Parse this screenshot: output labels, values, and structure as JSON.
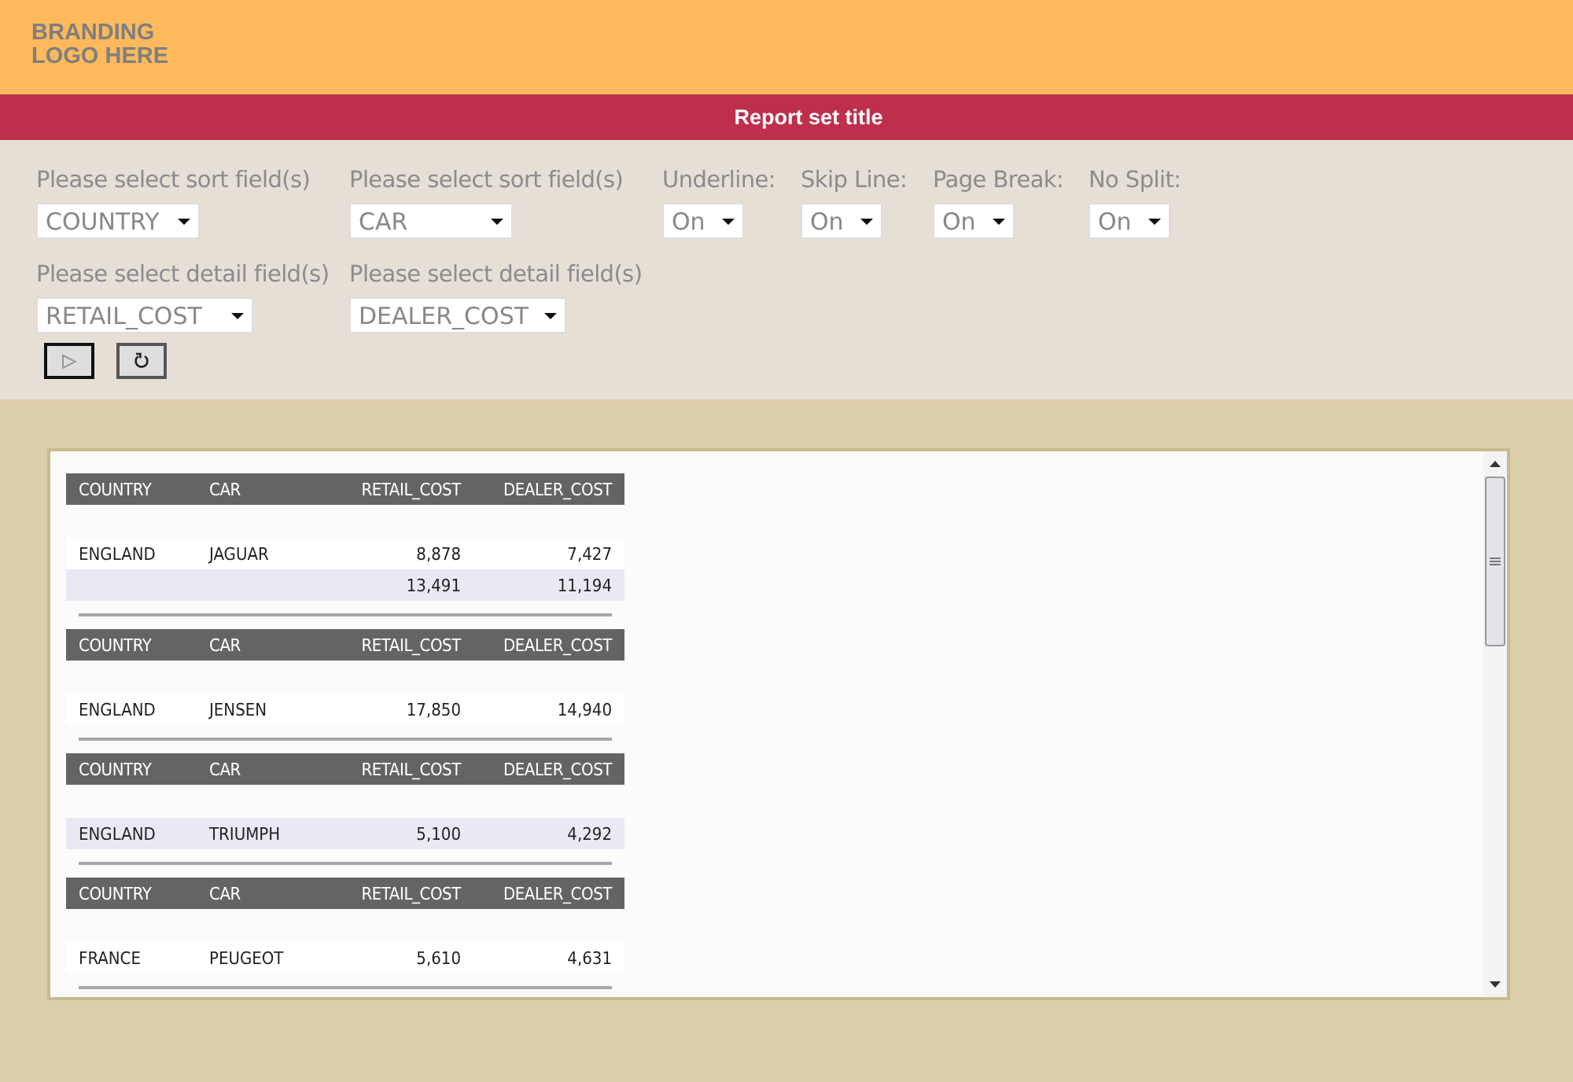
{
  "branding": {
    "lines": [
      "BRANDING",
      "LOGO HERE"
    ]
  },
  "title": "Report set title",
  "controls": [
    [
      {
        "label": "Please select sort field(s)",
        "value": "COUNTRY"
      },
      {
        "label": "Please select sort field(s)",
        "value": "CAR"
      },
      {
        "label": "Underline:",
        "value": "On"
      },
      {
        "label": "Skip Line:",
        "value": "On"
      },
      {
        "label": "Page Break:",
        "value": "On"
      },
      {
        "label": "No Split:",
        "value": "On"
      }
    ],
    [
      {
        "label": "Please select detail field(s)",
        "value": "RETAIL_COST"
      },
      {
        "label": "Please select detail field(s)",
        "value": "DEALER_COST"
      }
    ]
  ],
  "buttons": [
    {
      "kind": "run"
    },
    {
      "kind": "reset"
    }
  ],
  "report": {
    "groups": [
      {
        "columns": [
          "COUNTRY",
          "CAR",
          "RETAIL_COST",
          "DEALER_COST"
        ],
        "rows": [
          {
            "cells": [
              "ENGLAND",
              "JAGUAR",
              "8,878",
              "7,427"
            ],
            "shaded": false
          },
          {
            "cells": [
              "",
              "",
              "13,491",
              "11,194"
            ],
            "shaded": true
          }
        ]
      },
      {
        "columns": [
          "COUNTRY",
          "CAR",
          "RETAIL_COST",
          "DEALER_COST"
        ],
        "rows": [
          {
            "cells": [
              "ENGLAND",
              "JENSEN",
              "17,850",
              "14,940"
            ],
            "shaded": false
          }
        ]
      },
      {
        "columns": [
          "COUNTRY",
          "CAR",
          "RETAIL_COST",
          "DEALER_COST"
        ],
        "rows": [
          {
            "cells": [
              "ENGLAND",
              "TRIUMPH",
              "5,100",
              "4,292"
            ],
            "shaded": true
          }
        ]
      },
      {
        "columns": [
          "COUNTRY",
          "CAR",
          "RETAIL_COST",
          "DEALER_COST"
        ],
        "rows": [
          {
            "cells": [
              "FRANCE",
              "PEUGEOT",
              "5,610",
              "4,631"
            ],
            "shaded": false
          }
        ]
      }
    ]
  }
}
